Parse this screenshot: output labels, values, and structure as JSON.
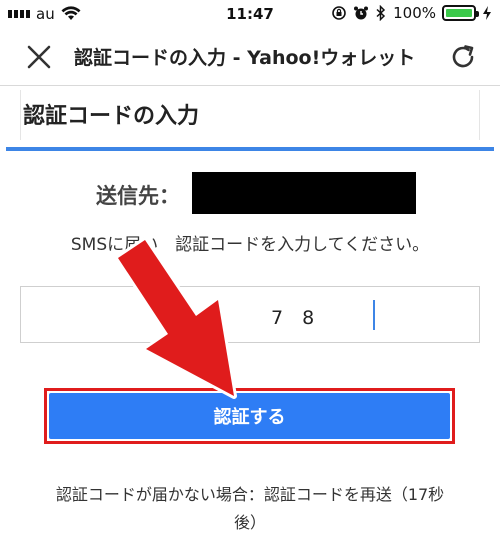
{
  "status_bar": {
    "carrier": "au",
    "time": "11:47",
    "battery": "100%",
    "battery_level": 1.0
  },
  "nav": {
    "title": "認証コードの入力 - Yahoo!ウォレット",
    "close_icon": "close-icon",
    "reload_icon": "reload-icon"
  },
  "page": {
    "heading": "認証コードの入力",
    "dest_label": "送信先：",
    "instruction": "SMSに届い　認証コードを入力してください。",
    "code_value": "7　8",
    "verify_label": "認証する",
    "resend_line1": "認証コードが届かない場合：認証コードを再送（17秒",
    "resend_line2": "後）"
  },
  "colors": {
    "accent_blue": "#2e7df5",
    "annotation_red": "#e01c1c",
    "battery_green": "#3bc94a"
  }
}
